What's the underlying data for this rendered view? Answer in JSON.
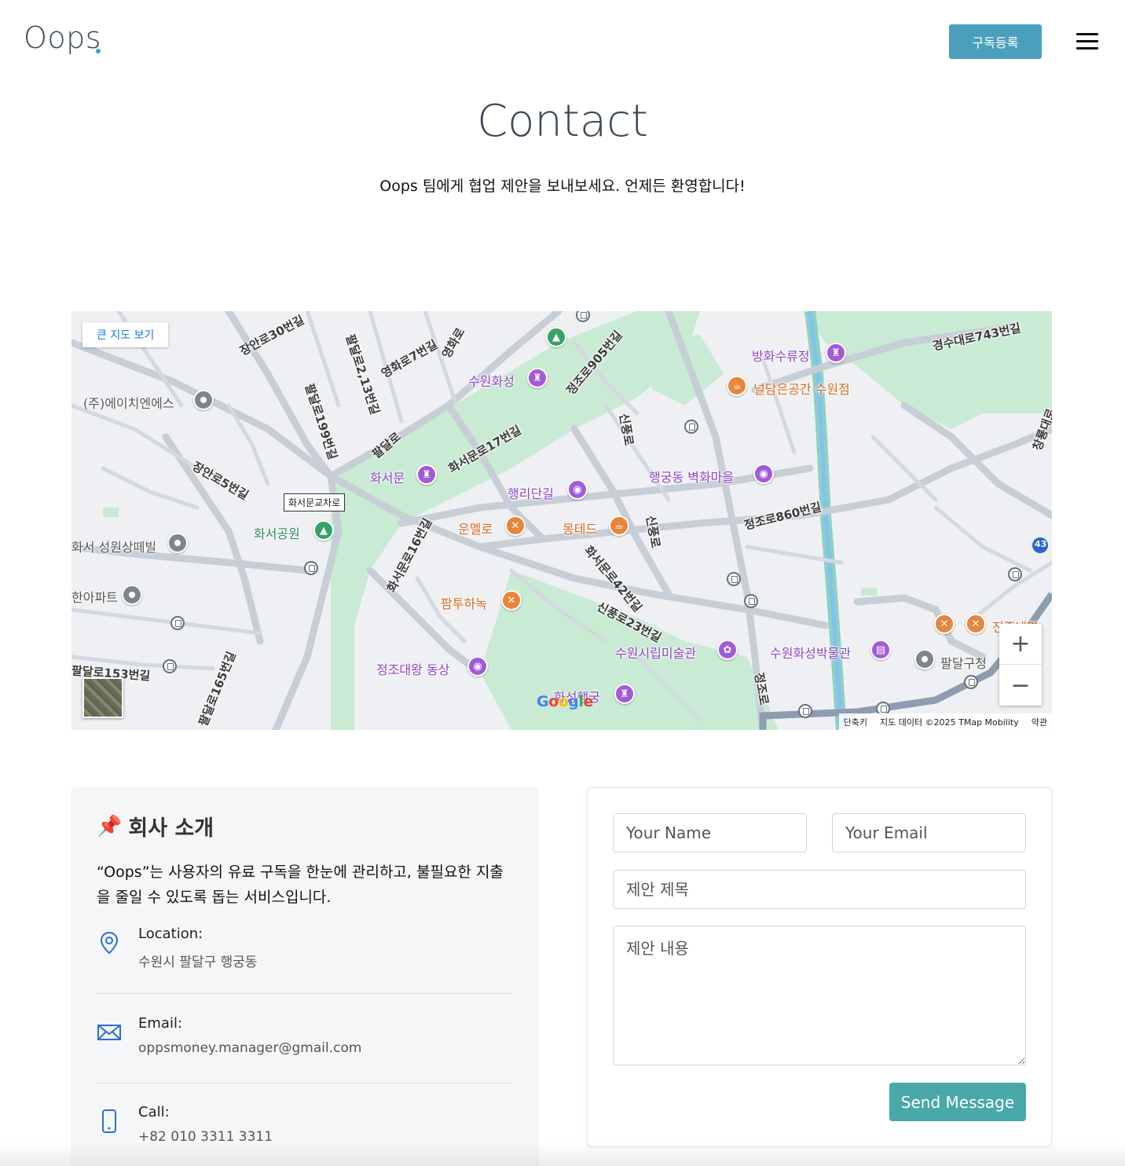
{
  "header": {
    "logo_text": "Oops",
    "subscribe_label": "구독등록",
    "menu_icon": "hamburger-icon"
  },
  "hero": {
    "title": "Contact",
    "subtitle": "Oops 팀에게 협업 제안을 보내보세요. 언제든 환영합니다!"
  },
  "map": {
    "large_map_label": "큰 지도 보기",
    "junction_tag": "화서문교차로",
    "labels": {
      "suwon_hwaseong": "수원화성",
      "banghwasuryujeong": "방화수류정",
      "neoldameun": "널담은공간 수원점",
      "hch": "(주)에이치엔에스",
      "hwaseomun": "화서문",
      "haengridangil": "행리단길",
      "byeokhwa": "행궁동 벽화마을",
      "hwaseo_park": "화서공원",
      "unmello": "운멜로",
      "mongted": "몽테드",
      "seongwon": "화서 성원상떼빌",
      "apt": "한아파트",
      "pamtu": "팜투하녹",
      "jeongjo_statue": "정조대왕 동상",
      "art_museum": "수원시립미술관",
      "hwaseong_museum": "수원화성박물관",
      "paldal_office": "팔달구청",
      "haenggung": "화성행궁",
      "jinju": "진주냉면"
    },
    "roads": {
      "janganro30": "장안로30번길",
      "paldalro2_13": "팔달로2,13번길",
      "yeonghwaro7": "영화로7번길",
      "yeonghwaro": "영화로",
      "jeongjoro905": "정조로905번길",
      "gyeongsudaero743": "경수대로743번길",
      "paldalro199": "팔달로199번길",
      "paldalro": "팔달로",
      "hwaseomunro17": "화서문로17번길",
      "sinpungro": "신풍로",
      "changryong": "창룡대로",
      "janganro5": "장안로5번길",
      "jeongjoro860": "정조로860번길",
      "hwaseomunro16": "화서문로16번길",
      "hwaseomunro42": "화서문로42번길",
      "sinpungro23": "신풍로23번길",
      "paldalro153": "팔달로153번길",
      "paldalro165": "팔달로165번길",
      "jeongjoro": "정조로",
      "route43": "43"
    },
    "zoom_in": "+",
    "zoom_out": "−",
    "google": "Google",
    "footer": {
      "shortcuts": "단축키",
      "data": "지도 데이터 ©2025 TMap Mobility",
      "terms": "약관"
    }
  },
  "info": {
    "title": "회사 소개",
    "title_icon": "pushpin-icon",
    "description": "“Oops”는 사용자의 유료 구독을 한눈에 관리하고, 불필요한 지출을 줄일 수 있도록 돕는 서비스입니다.",
    "location_label": "Location:",
    "location_value": "수원시 팔달구 행궁동",
    "email_label": "Email:",
    "email_value": "oppsmoney.manager@gmail.com",
    "call_label": "Call:",
    "call_value": "+82 010 3311 3311"
  },
  "form": {
    "name_placeholder": "Your Name",
    "email_placeholder": "Your Email",
    "subject_placeholder": "제안 제목",
    "message_placeholder": "제안 내용",
    "send_label": "Send Message"
  },
  "colors": {
    "accent": "#4a9fbd",
    "send_button": "#49a8a9",
    "map_park": "#c9ead3",
    "map_road": "#c7ced6"
  }
}
